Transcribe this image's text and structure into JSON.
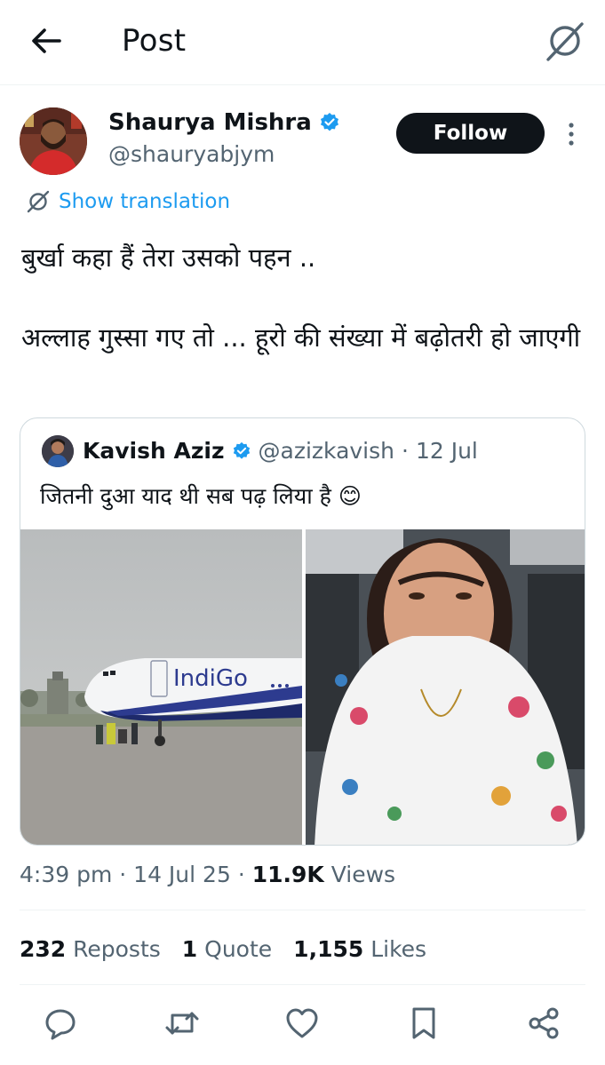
{
  "header": {
    "title": "Post",
    "back_icon": "arrow-left-icon",
    "translate_icon": "translate-icon"
  },
  "author": {
    "name": "Shaurya Mishra",
    "handle": "@shauryabjym",
    "verified": true,
    "follow_label": "Follow"
  },
  "translation": {
    "label": "Show translation"
  },
  "post": {
    "line1": "बुर्खा कहा हैं तेरा उसको पहन ..",
    "line2": "अल्लाह गुस्सा गए तो ... हूरो की संख्या में बढ़ोतरी हो जाएगी"
  },
  "quoted": {
    "name": "Kavish Aziz",
    "handle": "@azizkavish",
    "separator": "·",
    "date": "12 Jul",
    "text": "जितनी दुआ याद थी सब पढ़ लिया है 😊",
    "airline_label": "IndiGo"
  },
  "meta": {
    "time": "4:39 pm",
    "sep1": "·",
    "date": "14 Jul 25",
    "sep2": "·",
    "views_count": "11.9K",
    "views_label": "Views"
  },
  "stats": {
    "reposts_count": "232",
    "reposts_label": "Reposts",
    "quotes_count": "1",
    "quotes_label": "Quote",
    "likes_count": "1,155",
    "likes_label": "Likes"
  },
  "colors": {
    "accent": "#1d9bf0",
    "text": "#0f1419",
    "secondary": "#536471",
    "border": "#cfd9de"
  }
}
